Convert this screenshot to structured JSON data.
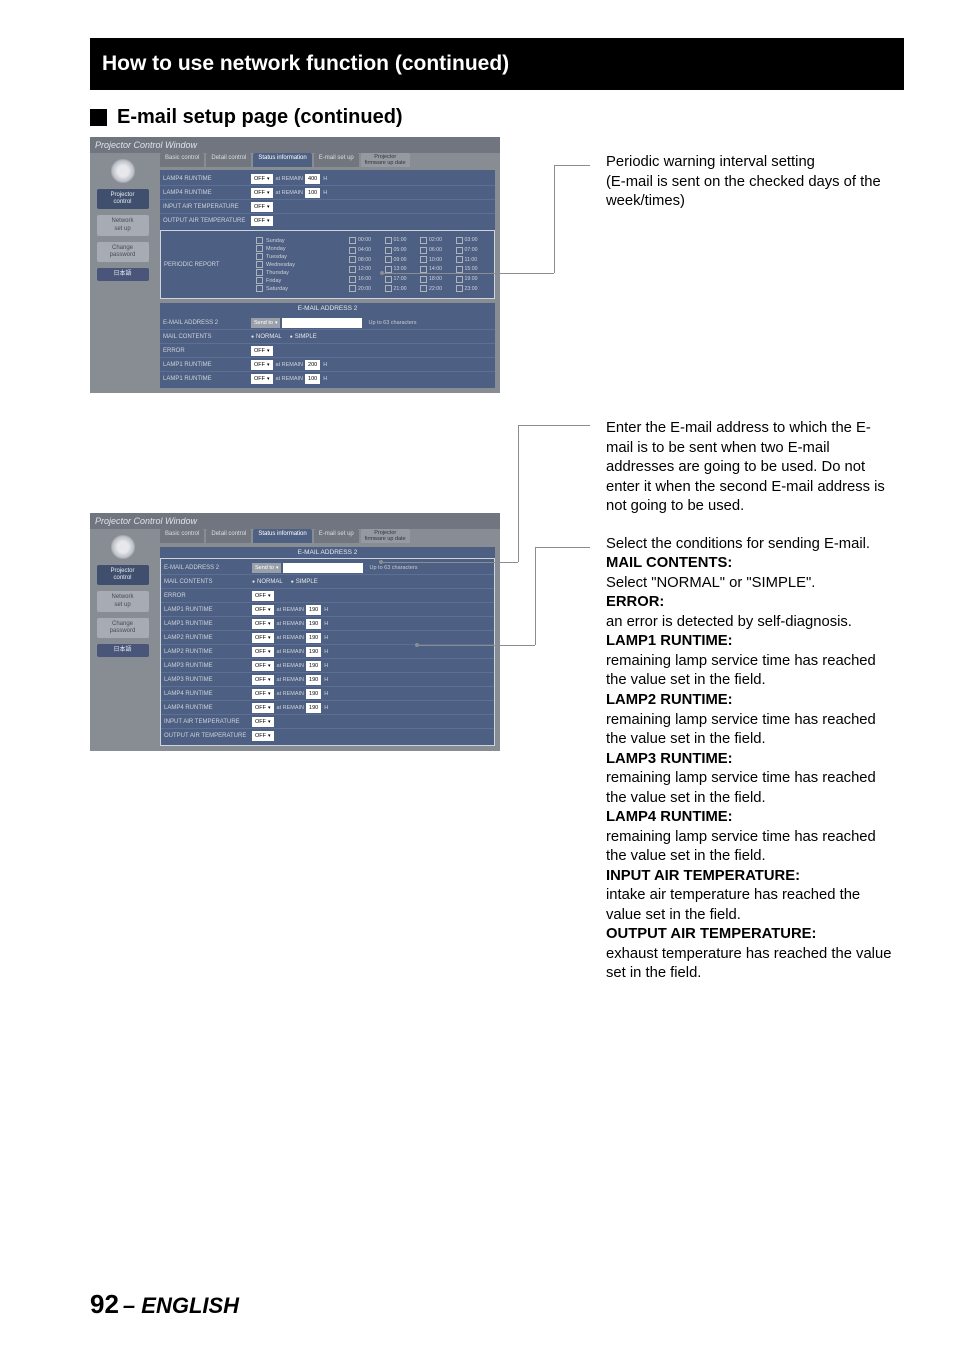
{
  "page_number": "92",
  "page_lang": "– ENGLISH",
  "title_bar": "How to use network function (continued)",
  "section_title": "E-mail setup page (continued)",
  "callouts": {
    "c1": "Periodic warning interval setting\n(E-mail is sent on the checked days of the week/times)",
    "c2": "Enter the E-mail address to which the E-mail is to be sent when two E-mail addresses are going to be used. Do not enter it when the second E-mail address is not going to be used.",
    "c3_lead": "Select the conditions for sending E-mail.",
    "c3_items": [
      {
        "h": "MAIL CONTENTS:",
        "t": "Select \"NORMAL\" or \"SIMPLE\"."
      },
      {
        "h": "ERROR:",
        "t": "an error is detected by self-diagnosis."
      },
      {
        "h": "LAMP1 RUNTIME:",
        "t": "remaining lamp service time has reached the value set in the field."
      },
      {
        "h": "LAMP2 RUNTIME:",
        "t": "remaining lamp service time has reached the value set in the field."
      },
      {
        "h": "LAMP3 RUNTIME:",
        "t": "remaining lamp service time has reached the value set in the field."
      },
      {
        "h": "LAMP4 RUNTIME:",
        "t": "remaining lamp service time has reached the value set in the field."
      },
      {
        "h": "INPUT AIR TEMPERATURE:",
        "t": "intake air temperature has reached the value set in the field."
      },
      {
        "h": "OUTPUT AIR TEMPERATURE:",
        "t": "exhaust temperature has reached the value set in the field."
      }
    ]
  },
  "win": {
    "title": "Projector Control Window",
    "sidebar": {
      "projector_control": "Projector\ncontrol",
      "network_setup": "Network\nset up",
      "change_password": "Change\npassword",
      "japanese": "日本語"
    },
    "tabs": {
      "basic": "Basic control",
      "detail": "Detail control",
      "status": "Status information",
      "email": "E-mail set up",
      "firmware": "Projector\nfirmware up date"
    },
    "panels": {
      "email2_hd": "E-MAIL ADDRESS 2",
      "rows1": [
        {
          "l": "LAMP4 RUNTIME",
          "sel": "OFF",
          "mid": "at REMAIN",
          "num": "400",
          "u": "H"
        },
        {
          "l": "LAMP4 RUNTIME",
          "sel": "OFF",
          "mid": "at REMAIN",
          "num": "100",
          "u": "H"
        },
        {
          "l": "INPUT AIR TEMPERATURE",
          "sel": "OFF"
        },
        {
          "l": "OUTPUT AIR TEMPERATURE",
          "sel": "OFF"
        }
      ],
      "periodic_label": "PERIODIC REPORT",
      "days": [
        "Sunday",
        "Monday",
        "Tuesday",
        "Wednesday",
        "Thursday",
        "Friday",
        "Saturday"
      ],
      "hours": [
        "00:00",
        "01:00",
        "02:00",
        "03:00",
        "04:00",
        "05:00",
        "06:00",
        "07:00",
        "08:00",
        "09:00",
        "10:00",
        "11:00",
        "12:00",
        "13:00",
        "14:00",
        "15:00",
        "16:00",
        "17:00",
        "18:00",
        "19:00",
        "20:00",
        "21:00",
        "22:00",
        "23:00"
      ],
      "addr2_row": {
        "l": "E-MAIL ADDRESS 2",
        "btn": "Send to",
        "note": "Up to 63 characters"
      },
      "mailcontents": {
        "l": "MAIL CONTENTS",
        "opt1": "NORMAL",
        "opt2": "SIMPLE"
      },
      "rows_bottom1": [
        {
          "l": "ERROR",
          "sel": "OFF"
        },
        {
          "l": "LAMP1 RUNTIME",
          "sel": "OFF",
          "mid": "at REMAIN",
          "num": "200",
          "u": "H"
        },
        {
          "l": "LAMP1 RUNTIME",
          "sel": "OFF",
          "mid": "at REMAIN",
          "num": "100",
          "u": "H"
        }
      ],
      "rows_fig2": [
        {
          "l": "E-MAIL ADDRESS 2",
          "btn": "Send to",
          "note": "Up to 63 characters"
        },
        {
          "l": "MAIL CONTENTS",
          "radios": true
        },
        {
          "l": "ERROR",
          "sel": "OFF"
        },
        {
          "l": "LAMP1 RUNTIME",
          "sel": "OFF",
          "mid": "at REMAIN",
          "num": "190",
          "u": "H"
        },
        {
          "l": "LAMP1 RUNTIME",
          "sel": "OFF",
          "mid": "at REMAIN",
          "num": "190",
          "u": "H"
        },
        {
          "l": "LAMP2 RUNTIME",
          "sel": "OFF",
          "mid": "at REMAIN",
          "num": "190",
          "u": "H"
        },
        {
          "l": "LAMP2 RUNTIME",
          "sel": "OFF",
          "mid": "at REMAIN",
          "num": "190",
          "u": "H"
        },
        {
          "l": "LAMP3 RUNTIME",
          "sel": "OFF",
          "mid": "at REMAIN",
          "num": "190",
          "u": "H"
        },
        {
          "l": "LAMP3 RUNTIME",
          "sel": "OFF",
          "mid": "at REMAIN",
          "num": "190",
          "u": "H"
        },
        {
          "l": "LAMP4 RUNTIME",
          "sel": "OFF",
          "mid": "at REMAIN",
          "num": "190",
          "u": "H"
        },
        {
          "l": "LAMP4 RUNTIME",
          "sel": "OFF",
          "mid": "at REMAIN",
          "num": "190",
          "u": "H"
        },
        {
          "l": "INPUT AIR TEMPERATURE",
          "sel": "OFF"
        },
        {
          "l": "OUTPUT AIR TEMPERATURE",
          "sel": "OFF"
        }
      ]
    }
  }
}
